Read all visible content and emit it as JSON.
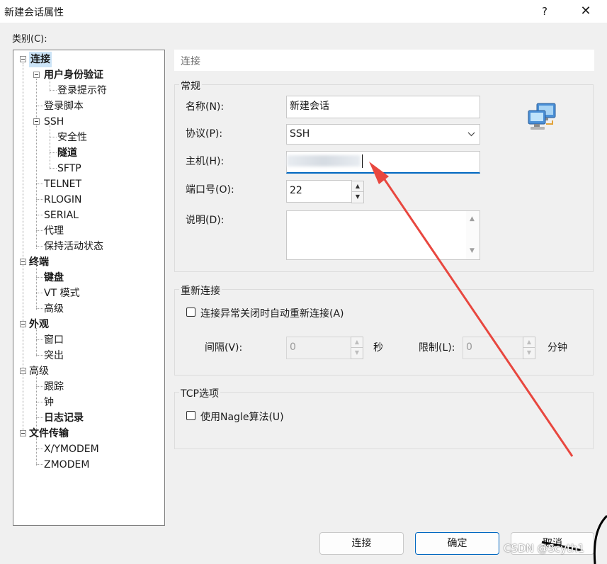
{
  "window": {
    "title": "新建会话属性",
    "help": "?",
    "close": "✕"
  },
  "category_label": "类别(C):",
  "tree": [
    {
      "label": "连接",
      "bold": true,
      "selected": true
    },
    {
      "label": "用户身份验证",
      "bold": true
    },
    {
      "label": "登录提示符"
    },
    {
      "label": "登录脚本"
    },
    {
      "label": "SSH"
    },
    {
      "label": "安全性"
    },
    {
      "label": "隧道",
      "bold": true
    },
    {
      "label": "SFTP"
    },
    {
      "label": "TELNET"
    },
    {
      "label": "RLOGIN"
    },
    {
      "label": "SERIAL"
    },
    {
      "label": "代理"
    },
    {
      "label": "保持活动状态"
    },
    {
      "label": "终端",
      "bold": true
    },
    {
      "label": "键盘",
      "bold": true
    },
    {
      "label": "VT 模式"
    },
    {
      "label": "高级"
    },
    {
      "label": "外观",
      "bold": true
    },
    {
      "label": "窗口"
    },
    {
      "label": "突出"
    },
    {
      "label": "高级"
    },
    {
      "label": "跟踪"
    },
    {
      "label": "钟"
    },
    {
      "label": "日志记录",
      "bold": true
    },
    {
      "label": "文件传输",
      "bold": true
    },
    {
      "label": "X/YMODEM"
    },
    {
      "label": "ZMODEM"
    }
  ],
  "page_header": "连接",
  "general": {
    "group_label": "常规",
    "name_label": "名称(N):",
    "name_value": "新建会话",
    "protocol_label": "协议(P):",
    "protocol_value": "SSH",
    "host_label": "主机(H):",
    "host_value": "",
    "port_label": "端口号(O):",
    "port_value": "22",
    "desc_label": "说明(D):",
    "desc_value": ""
  },
  "reconnect": {
    "group_label": "重新连接",
    "checkbox_label": "连接异常关闭时自动重新连接(A)",
    "interval_label": "间隔(V):",
    "interval_value": "0",
    "interval_unit": "秒",
    "limit_label": "限制(L):",
    "limit_value": "0",
    "limit_unit": "分钟"
  },
  "tcp": {
    "group_label": "TCP选项",
    "checkbox_label": "使用Nagle算法(U)"
  },
  "buttons": {
    "connect": "连接",
    "ok": "确定",
    "cancel": "取消"
  },
  "watermark": "CSDN @Scyth1",
  "colors": {
    "accent": "#0067c0",
    "annotation_arrow": "#e8473f",
    "selection": "#cce4f7"
  },
  "icons": {
    "session": "network-computers-icon"
  }
}
